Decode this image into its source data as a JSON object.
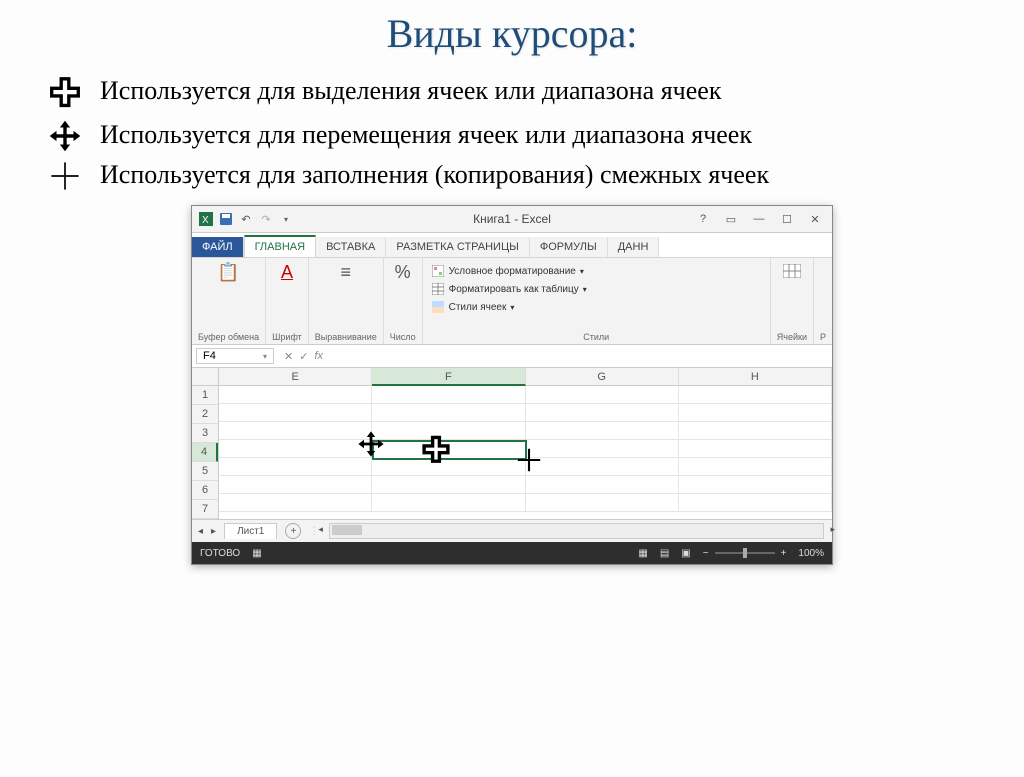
{
  "title": "Виды курсора:",
  "cursors": [
    {
      "name": "select-cursor",
      "desc": "Используется для выделения ячеек или диапазона ячеек"
    },
    {
      "name": "move-cursor",
      "desc": "Используется для перемещения ячеек или диапазона ячеек"
    },
    {
      "name": "fill-cursor",
      "desc": "Используется для заполнения (копирования) смежных ячеек"
    }
  ],
  "excel": {
    "title": "Книга1 - Excel",
    "tabs": {
      "file": "ФАЙЛ",
      "home": "ГЛАВНАЯ",
      "insert": "ВСТАВКА",
      "layout": "РАЗМЕТКА СТРАНИЦЫ",
      "formulas": "ФОРМУЛЫ",
      "data": "ДАНН"
    },
    "ribbon": {
      "clipboard": "Буфер обмена",
      "font": "Шрифт",
      "align": "Выравнивание",
      "number": "Число",
      "cond_format": "Условное форматирование",
      "format_table": "Форматировать как таблицу",
      "cell_styles": "Стили ячеек",
      "styles": "Стили",
      "cells": "Ячейки",
      "edit": "Р"
    },
    "namebox": "F4",
    "columns": [
      "E",
      "F",
      "G",
      "H"
    ],
    "rows": [
      "1",
      "2",
      "3",
      "4",
      "5",
      "6",
      "7"
    ],
    "selected_col_index": 1,
    "selected_row_index": 3,
    "sheet": "Лист1",
    "status": "ГОТОВО",
    "zoom": "100%"
  }
}
